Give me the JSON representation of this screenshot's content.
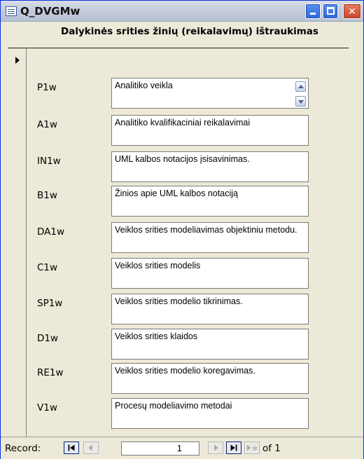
{
  "window": {
    "title": "Q_DVGMw"
  },
  "form": {
    "header_title": "Dalykinės srities žinių (reikalavimų) ištraukimas",
    "rows": [
      {
        "label": "P1w",
        "value": "Analitiko veikla"
      },
      {
        "label": "A1w",
        "value": "Analitiko kvalifikaciniai reikalavimai"
      },
      {
        "label": "IN1w",
        "value": "UML kalbos notacijos įsisavinimas."
      },
      {
        "label": "B1w",
        "value": "Žinios apie UML kalbos notaciją"
      },
      {
        "label": "DA1w",
        "value": "Veiklos srities modeliavimas objektiniu metodu."
      },
      {
        "label": "C1w",
        "value": "Veiklos srities modelis"
      },
      {
        "label": "SP1w",
        "value": "Veiklos srities modelio tikrinimas."
      },
      {
        "label": "D1w",
        "value": "Veiklos srities klaidos"
      },
      {
        "label": "RE1w",
        "value": "Veiklos srities modelio koregavimas."
      },
      {
        "label": "V1w",
        "value": "Procesų modeliavimo metodai"
      }
    ]
  },
  "navigation": {
    "record_label": "Record:",
    "current_record": "1",
    "of_text": "of 1"
  },
  "icons": {
    "window": "form-icon",
    "first": "first-record-icon",
    "prev": "previous-record-icon",
    "next": "next-record-icon",
    "last": "last-record-icon",
    "new": "new-record-icon"
  }
}
